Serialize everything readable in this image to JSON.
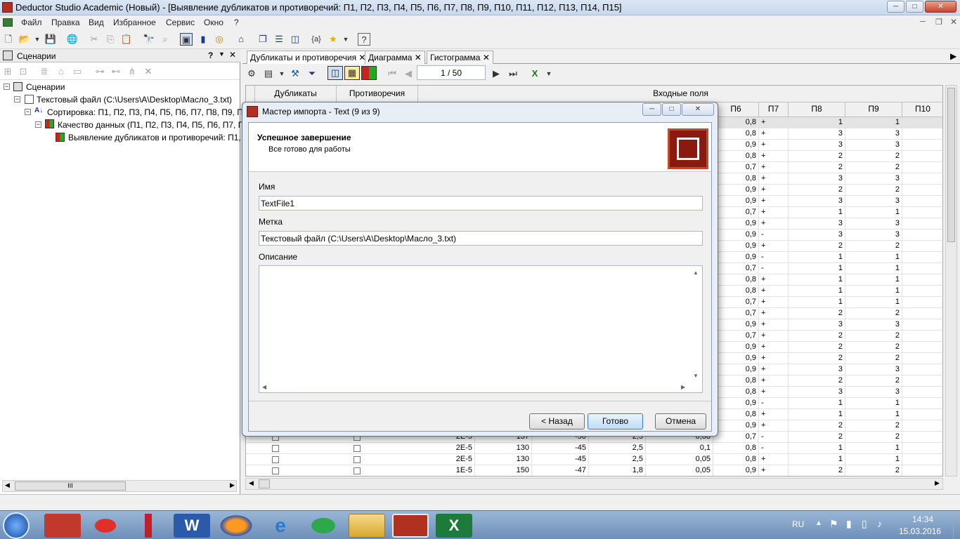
{
  "window": {
    "title": "Deductor Studio Academic (Новый) - [Выявление дубликатов и противоречий: П1, П2, П3, П4, П5, П6, П7, П8, П9, П10, П11, П12, П13, П14, П15]"
  },
  "menu": [
    "Файл",
    "Правка",
    "Вид",
    "Избранное",
    "Сервис",
    "Окно",
    "?"
  ],
  "left_panel": {
    "title": "Сценарии",
    "help": "?",
    "tree": [
      {
        "label": "Сценарии",
        "level": 0
      },
      {
        "label": "Текстовый файл (C:\\Users\\A\\Desktop\\Масло_3.txt)",
        "level": 1
      },
      {
        "label": "Сортировка: П1, П2, П3, П4, П5, П6, П7, П8, П9, П10,",
        "level": 2
      },
      {
        "label": "Качество данных (П1, П2, П3, П4, П5, П6, П7, П8, П",
        "level": 3
      },
      {
        "label": "Выявление дубликатов и противоречий: П1, П2",
        "level": 4
      }
    ],
    "scroll_label": "III"
  },
  "tabs": [
    {
      "label": "Дубликаты и противоречия",
      "active": true
    },
    {
      "label": "Диаграмма",
      "active": false
    },
    {
      "label": "Гистограмма",
      "active": false
    }
  ],
  "pager": {
    "value": "1 / 50"
  },
  "grid": {
    "group_headers": {
      "dup": "Дубликаты",
      "contr": "Противоречия",
      "input": "Входные поля"
    },
    "col_headers": [
      "П6",
      "П7",
      "П8",
      "П9",
      "П10"
    ],
    "rows": [
      [
        "0,8",
        "+",
        "1",
        "1"
      ],
      [
        "0,8",
        "+",
        "3",
        "3"
      ],
      [
        "0,9",
        "+",
        "3",
        "3"
      ],
      [
        "0,8",
        "+",
        "2",
        "2"
      ],
      [
        "0,7",
        "+",
        "2",
        "2"
      ],
      [
        "0,8",
        "+",
        "3",
        "3"
      ],
      [
        "0,9",
        "+",
        "2",
        "2"
      ],
      [
        "0,9",
        "+",
        "3",
        "3"
      ],
      [
        "0,7",
        "+",
        "1",
        "1"
      ],
      [
        "0,9",
        "+",
        "3",
        "3"
      ],
      [
        "0,9",
        "-",
        "3",
        "3"
      ],
      [
        "0,9",
        "+",
        "2",
        "2"
      ],
      [
        "0,9",
        "-",
        "1",
        "1"
      ],
      [
        "0,7",
        "-",
        "1",
        "1"
      ],
      [
        "0,8",
        "+",
        "1",
        "1"
      ],
      [
        "0,8",
        "+",
        "1",
        "1"
      ],
      [
        "0,7",
        "+",
        "1",
        "1"
      ],
      [
        "0,7",
        "+",
        "2",
        "2"
      ],
      [
        "0,9",
        "+",
        "3",
        "3"
      ],
      [
        "0,7",
        "+",
        "2",
        "2"
      ],
      [
        "0,9",
        "+",
        "2",
        "2"
      ],
      [
        "0,9",
        "+",
        "2",
        "2"
      ],
      [
        "0,9",
        "+",
        "3",
        "3"
      ],
      [
        "0,8",
        "+",
        "2",
        "2"
      ],
      [
        "0,8",
        "+",
        "3",
        "3"
      ],
      [
        "0,9",
        "-",
        "1",
        "1"
      ],
      [
        "0,8",
        "+",
        "1",
        "1"
      ],
      [
        "0,9",
        "+",
        "2",
        "2"
      ]
    ],
    "bottom_rows": [
      {
        "a": "2E-5",
        "b": "137",
        "c": "-50",
        "d": "2,5",
        "e": "0,08",
        "f": "0,7",
        "g": "-",
        "h": "2",
        "i": "2"
      },
      {
        "a": "2E-5",
        "b": "130",
        "c": "-45",
        "d": "2,5",
        "e": "0,1",
        "f": "0,8",
        "g": "-",
        "h": "1",
        "i": "1"
      },
      {
        "a": "2E-5",
        "b": "130",
        "c": "-45",
        "d": "2,5",
        "e": "0,05",
        "f": "0,8",
        "g": "+",
        "h": "1",
        "i": "1"
      },
      {
        "a": "1E-5",
        "b": "150",
        "c": "-47",
        "d": "1,8",
        "e": "0,05",
        "f": "0,9",
        "g": "+",
        "h": "2",
        "i": "2"
      }
    ]
  },
  "dialog": {
    "title": "Мастер импорта - Text (9 из 9)",
    "header_title": "Успешное завершение",
    "header_subtitle": "Все готово для работы",
    "name_label": "Имя",
    "name_value": "TextFile1",
    "tag_label": "Метка",
    "tag_value": "Текстовый файл (C:\\Users\\A\\Desktop\\Масло_3.txt)",
    "desc_label": "Описание",
    "back_button": "< Назад",
    "finish_button": "Готово",
    "cancel_button": "Отмена"
  },
  "taskbar": {
    "lang": "RU",
    "time": "14:34",
    "date": "15.03.2016"
  },
  "colors": {
    "accent": "#b23020",
    "taskbar": "#7a9cc4",
    "selection": "#3399ff"
  }
}
